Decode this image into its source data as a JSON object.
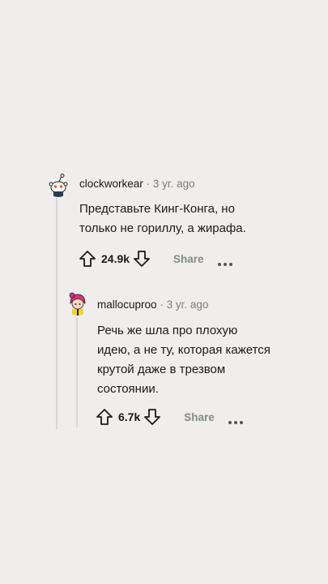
{
  "comments": [
    {
      "author": "clockworkear",
      "separator": "·",
      "time": "3 yr. ago",
      "text_lines": [
        "Представьте Кинг-Конга, но",
        "только не гориллу, а жирафа."
      ],
      "votes": "24.9k",
      "share_label": "Share",
      "avatar_icon": "snoo-avatar-icon"
    },
    {
      "author": "mallocuproo",
      "separator": "·",
      "time": "3 yr. ago",
      "text_lines": [
        "Речь же шла про плохую",
        "идею, а не ту, которая кажется",
        "крутой даже в трезвом",
        "состоянии."
      ],
      "votes": "6.7k",
      "share_label": "Share",
      "avatar_icon": "pink-hair-avatar-icon"
    }
  ],
  "colors": {
    "background": "#efeeec",
    "thread_line": "#d7d7d5",
    "muted": "#878a8c"
  }
}
